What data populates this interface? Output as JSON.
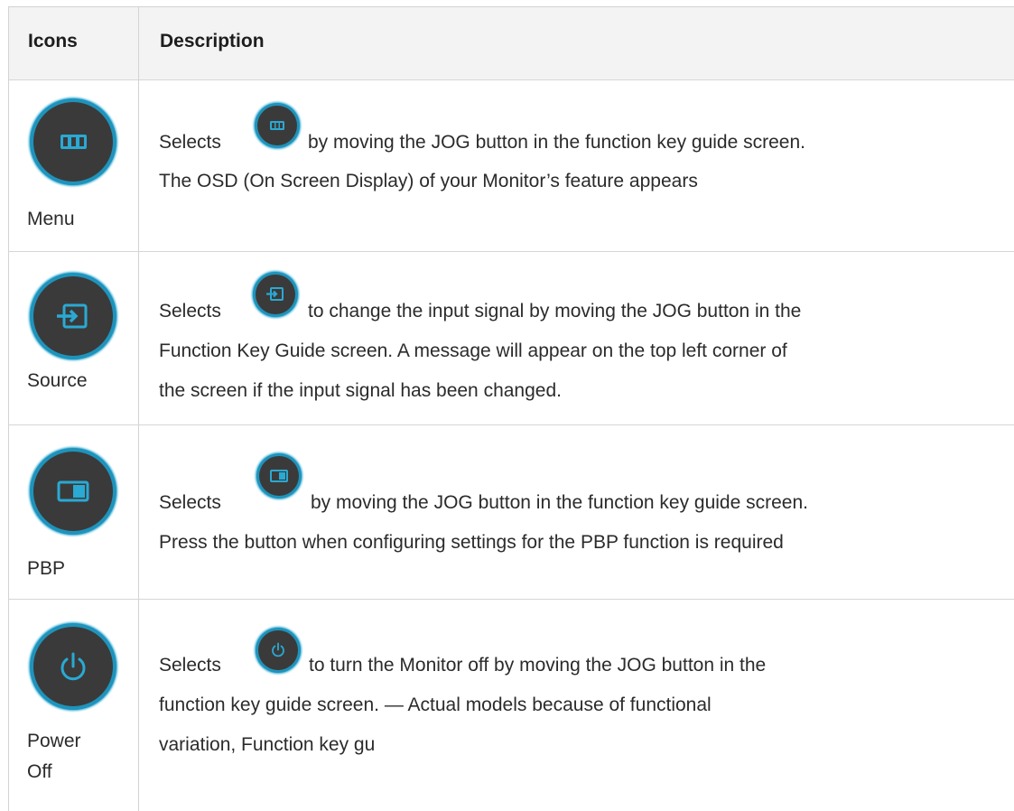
{
  "header": {
    "col_icons": "Icons",
    "col_description": "Description"
  },
  "rows": [
    {
      "name": "menu",
      "label_lines": [
        "Menu"
      ],
      "icon": "menu-icon",
      "desc_start": "Selects",
      "desc_lines": [
        "by moving the JOG button in the function key guide screen.",
        "The OSD (On Screen Display) of your Monitor’s feature appears"
      ]
    },
    {
      "name": "source",
      "label_lines": [
        "Source"
      ],
      "icon": "source-icon",
      "desc_start": "Selects",
      "desc_lines": [
        "to change the input signal by moving the JOG button in the",
        "Function Key Guide screen. A message will appear on the top left corner of",
        "the screen if the input signal has been changed."
      ]
    },
    {
      "name": "pbp",
      "label_lines": [
        "PBP"
      ],
      "icon": "pbp-icon",
      "desc_start": "Selects",
      "desc_lines": [
        "by moving the JOG button in the function key guide screen.",
        "Press the button when configuring settings for the PBP function is required"
      ]
    },
    {
      "name": "power-off",
      "label_lines": [
        "Power",
        "Off"
      ],
      "icon": "power-icon",
      "desc_start": "Selects",
      "desc_lines": [
        "to turn the Monitor off by moving the JOG button in the",
        "function key guide screen. — Actual models because of functional",
        "variation, Function key gu"
      ]
    }
  ]
}
